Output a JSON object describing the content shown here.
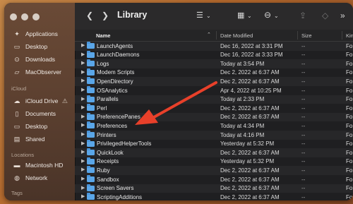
{
  "toolbar": {
    "back_icon": "chevron-left-icon",
    "forward_icon": "chevron-right-icon",
    "title": "Library"
  },
  "sidebar": {
    "favorites": [
      {
        "label": "Applications",
        "icon": "applications-icon"
      },
      {
        "label": "Desktop",
        "icon": "desktop-icon"
      },
      {
        "label": "Downloads",
        "icon": "downloads-icon"
      },
      {
        "label": "MacObserver",
        "icon": "folder-icon"
      }
    ],
    "icloud_header": "iCloud",
    "icloud": [
      {
        "label": "iCloud Drive",
        "icon": "cloud-icon"
      },
      {
        "label": "Documents",
        "icon": "document-icon"
      },
      {
        "label": "Desktop",
        "icon": "desktop-icon"
      },
      {
        "label": "Shared",
        "icon": "shared-folder-icon"
      }
    ],
    "locations_header": "Locations",
    "locations": [
      {
        "label": "Macintosh HD",
        "icon": "hard-drive-icon"
      },
      {
        "label": "Network",
        "icon": "globe-icon"
      }
    ],
    "tags_header": "Tags"
  },
  "columns": {
    "name": "Name",
    "date": "Date Modified",
    "size": "Size",
    "kind": "Kind"
  },
  "rows": [
    {
      "name": "LaunchAgents",
      "date": "Dec 16, 2022 at 3:31 PM",
      "size": "--",
      "kind": "Fo"
    },
    {
      "name": "LaunchDaemons",
      "date": "Dec 16, 2022 at 3:33 PM",
      "size": "--",
      "kind": "Fo"
    },
    {
      "name": "Logs",
      "date": "Today at 3:54 PM",
      "size": "--",
      "kind": "Fo"
    },
    {
      "name": "Modem Scripts",
      "date": "Dec 2, 2022 at 6:37 AM",
      "size": "--",
      "kind": "Fo"
    },
    {
      "name": "OpenDirectory",
      "date": "Dec 2, 2022 at 6:37 AM",
      "size": "--",
      "kind": "Fo"
    },
    {
      "name": "OSAnalytics",
      "date": "Apr 4, 2022 at 10:25 PM",
      "size": "--",
      "kind": "Fo"
    },
    {
      "name": "Parallels",
      "date": "Today at 2:33 PM",
      "size": "--",
      "kind": "Fo"
    },
    {
      "name": "Perl",
      "date": "Dec 2, 2022 at 6:37 AM",
      "size": "--",
      "kind": "Fo"
    },
    {
      "name": "PreferencePanes",
      "date": "Dec 2, 2022 at 6:37 AM",
      "size": "--",
      "kind": "Fo"
    },
    {
      "name": "Preferences",
      "date": "Today at 4:34 PM",
      "size": "--",
      "kind": "Fo"
    },
    {
      "name": "Printers",
      "date": "Today at 4:16 PM",
      "size": "--",
      "kind": "Fo"
    },
    {
      "name": "PrivilegedHelperTools",
      "date": "Yesterday at 5:32 PM",
      "size": "--",
      "kind": "Fo"
    },
    {
      "name": "QuickLook",
      "date": "Dec 2, 2022 at 6:37 AM",
      "size": "--",
      "kind": "Fo"
    },
    {
      "name": "Receipts",
      "date": "Yesterday at 5:32 PM",
      "size": "--",
      "kind": "Fo"
    },
    {
      "name": "Ruby",
      "date": "Dec 2, 2022 at 6:37 AM",
      "size": "--",
      "kind": "Fo"
    },
    {
      "name": "Sandbox",
      "date": "Dec 2, 2022 at 6:37 AM",
      "size": "--",
      "kind": "Fo"
    },
    {
      "name": "Screen Savers",
      "date": "Dec 2, 2022 at 6:37 AM",
      "size": "--",
      "kind": "Fo"
    },
    {
      "name": "ScriptingAdditions",
      "date": "Dec 2, 2022 at 6:37 AM",
      "size": "--",
      "kind": "Fo"
    }
  ],
  "annotation": {
    "color": "#e8402a"
  }
}
